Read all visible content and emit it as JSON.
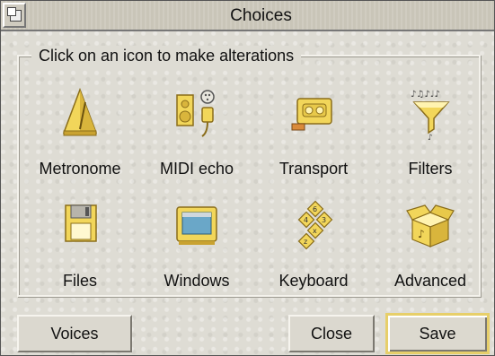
{
  "window": {
    "title": "Choices"
  },
  "group": {
    "label": "Click on an icon to make alterations"
  },
  "icons": [
    {
      "label": "Metronome",
      "icon": "metronome-icon"
    },
    {
      "label": "MIDI echo",
      "icon": "midi-echo-icon"
    },
    {
      "label": "Transport",
      "icon": "transport-icon"
    },
    {
      "label": "Filters",
      "icon": "filters-icon"
    },
    {
      "label": "Files",
      "icon": "files-icon"
    },
    {
      "label": "Windows",
      "icon": "windows-icon"
    },
    {
      "label": "Keyboard",
      "icon": "keyboard-icon"
    },
    {
      "label": "Advanced",
      "icon": "advanced-icon"
    }
  ],
  "buttons": {
    "voices": "Voices",
    "close": "Close",
    "save": "Save"
  },
  "colors": {
    "icon_yellow": "#f2d65a",
    "default_button_border": "#e7cf6a"
  }
}
